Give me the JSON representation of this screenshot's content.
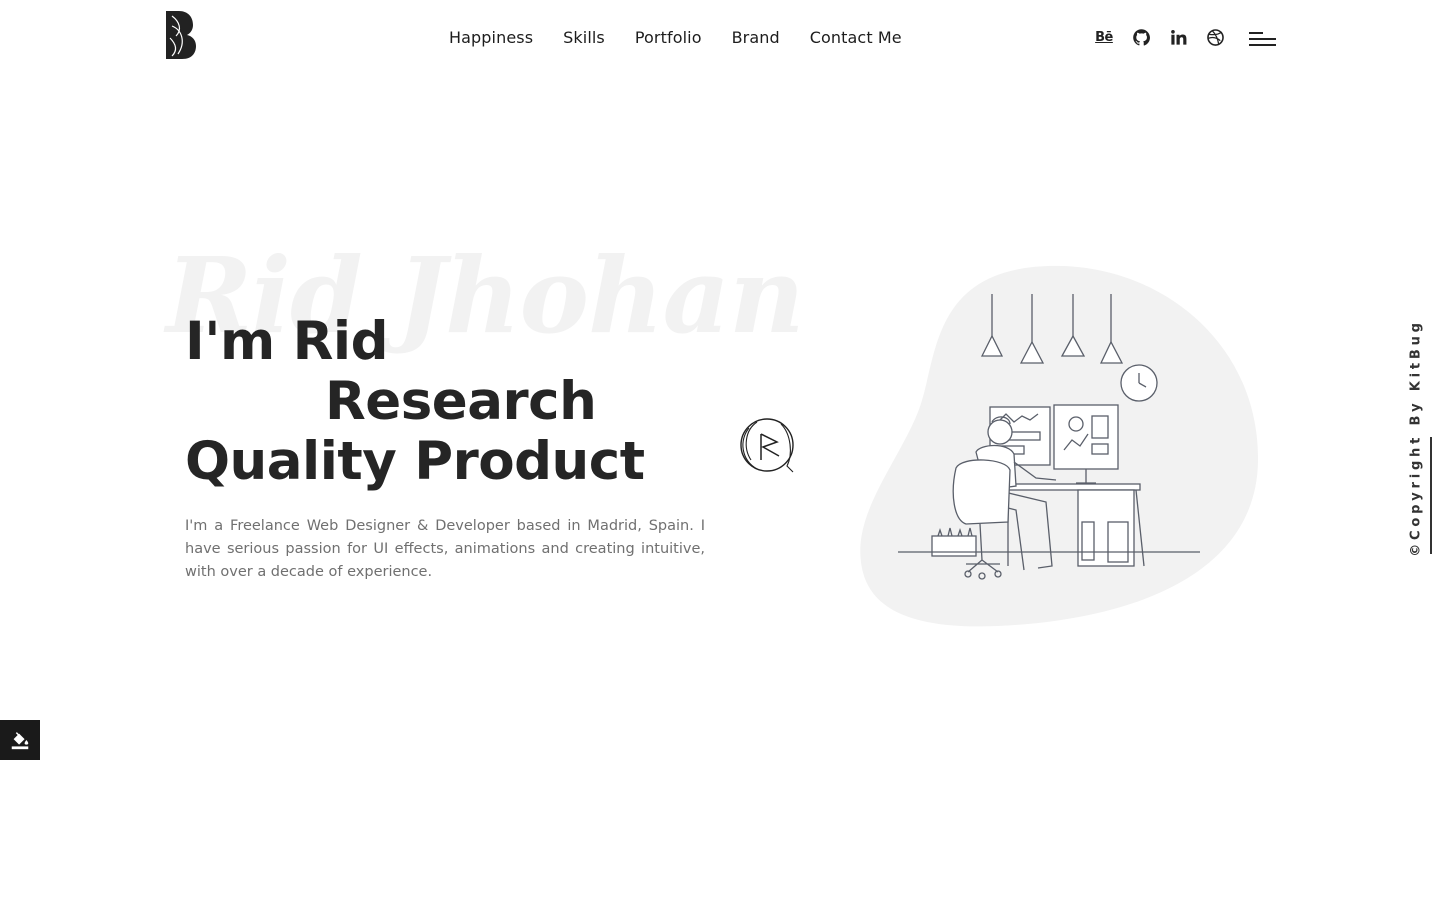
{
  "header": {
    "logo": "B",
    "nav": [
      {
        "label": "Happiness"
      },
      {
        "label": "Skills"
      },
      {
        "label": "Portfolio"
      },
      {
        "label": "Brand"
      },
      {
        "label": "Contact Me"
      }
    ],
    "socials": [
      {
        "icon": "behance-icon",
        "text": "Bē"
      },
      {
        "icon": "github-icon"
      },
      {
        "icon": "linkedin-icon"
      },
      {
        "icon": "dribbble-icon"
      }
    ],
    "menu_icon": "hamburger-menu-icon"
  },
  "hero": {
    "background_name": "Rid Jhohan",
    "headline": {
      "line1": "I'm Rid",
      "line2": "Research",
      "line3": "Quality Product"
    },
    "intro": "I'm a Freelance Web Designer & Developer based in Madrid, Spain. I have serious passion for UI effects, animations and creating intuitive, with over a decade of experience."
  },
  "sidebar": {
    "copyright": "©Copyright By KitBug"
  },
  "colors": {
    "text": "#252525",
    "muted": "#707070",
    "blob": "#f2f2f2",
    "watermark": "#f2f2f2",
    "dark_button": "#1a1a1a"
  }
}
